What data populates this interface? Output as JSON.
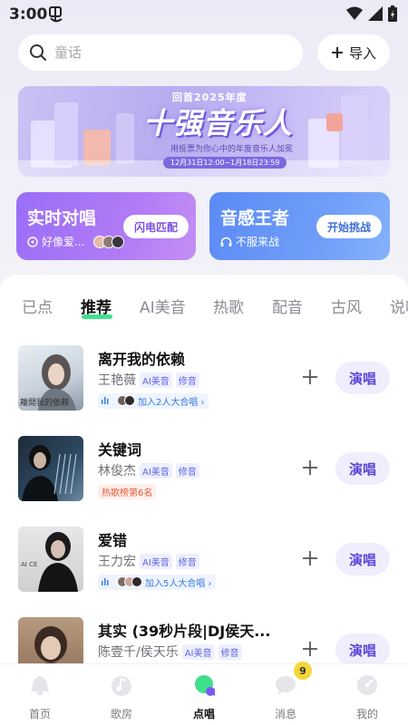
{
  "status_bar": {
    "time": "3:00",
    "icons": [
      "app-notification-icon",
      "wifi-icon",
      "signal-icon",
      "battery-icon"
    ]
  },
  "search": {
    "placeholder": "童话",
    "import_label": "导入"
  },
  "banner": {
    "top_text": "回首2025年度",
    "title": "十强音乐人",
    "description": "用投票为你心中的年度音乐人加冕",
    "date_range": "12月31日12:00~1月18日23:59"
  },
  "cards": {
    "duet": {
      "title": "实时对唱",
      "subtitle": "好像爱...",
      "button": "闪电匹配"
    },
    "rhythm": {
      "title": "音感王者",
      "subtitle": "不服来战",
      "button": "开始挑战"
    }
  },
  "tabs": [
    {
      "label": "已点",
      "active": false
    },
    {
      "label": "推荐",
      "active": true
    },
    {
      "label": "AI美音",
      "active": false
    },
    {
      "label": "热歌",
      "active": false
    },
    {
      "label": "配音",
      "active": false
    },
    {
      "label": "古风",
      "active": false
    },
    {
      "label": "说唱",
      "active": false
    }
  ],
  "songs": [
    {
      "title": "离开我的依赖",
      "artist": "王艳薇",
      "badges": [
        "AI美音",
        "修音"
      ],
      "extra": "加入2人大合唱 ›",
      "extra_type": "chorus",
      "action": "演唱",
      "cover_text": "離開我的依賴"
    },
    {
      "title": "关键词",
      "artist": "林俊杰",
      "badges": [
        "AI美音",
        "修音"
      ],
      "extra": "热歌榜第6名",
      "extra_type": "rank",
      "action": "演唱"
    },
    {
      "title": "爱错",
      "artist": "王力宏",
      "badges": [
        "AI美音",
        "修音"
      ],
      "extra": "加入5人大合唱 ›",
      "extra_type": "chorus",
      "action": "演唱"
    },
    {
      "title": "其实 (39秒片段|DJ侯天...",
      "artist": "陈壹千/侯天乐",
      "badges": [
        "AI美音",
        "修音"
      ],
      "extra": "",
      "extra_type": "none",
      "action": "演唱"
    }
  ],
  "bottom_nav": {
    "items": [
      {
        "label": "首页",
        "icon": "bell-home-icon",
        "active": false
      },
      {
        "label": "歌房",
        "icon": "music-note-icon",
        "active": false
      },
      {
        "label": "点唱",
        "icon": "sing-icon",
        "active": true
      },
      {
        "label": "消息",
        "icon": "chat-bubble-icon",
        "active": false
      },
      {
        "label": "我的",
        "icon": "profile-icon",
        "active": false
      }
    ],
    "message_badge": "9"
  },
  "colors": {
    "accent_green": "#40e08e",
    "sing_button_text": "#5a45d8",
    "duet_card": "#9a6ef7",
    "rhythm_card": "#5a8bf5"
  }
}
